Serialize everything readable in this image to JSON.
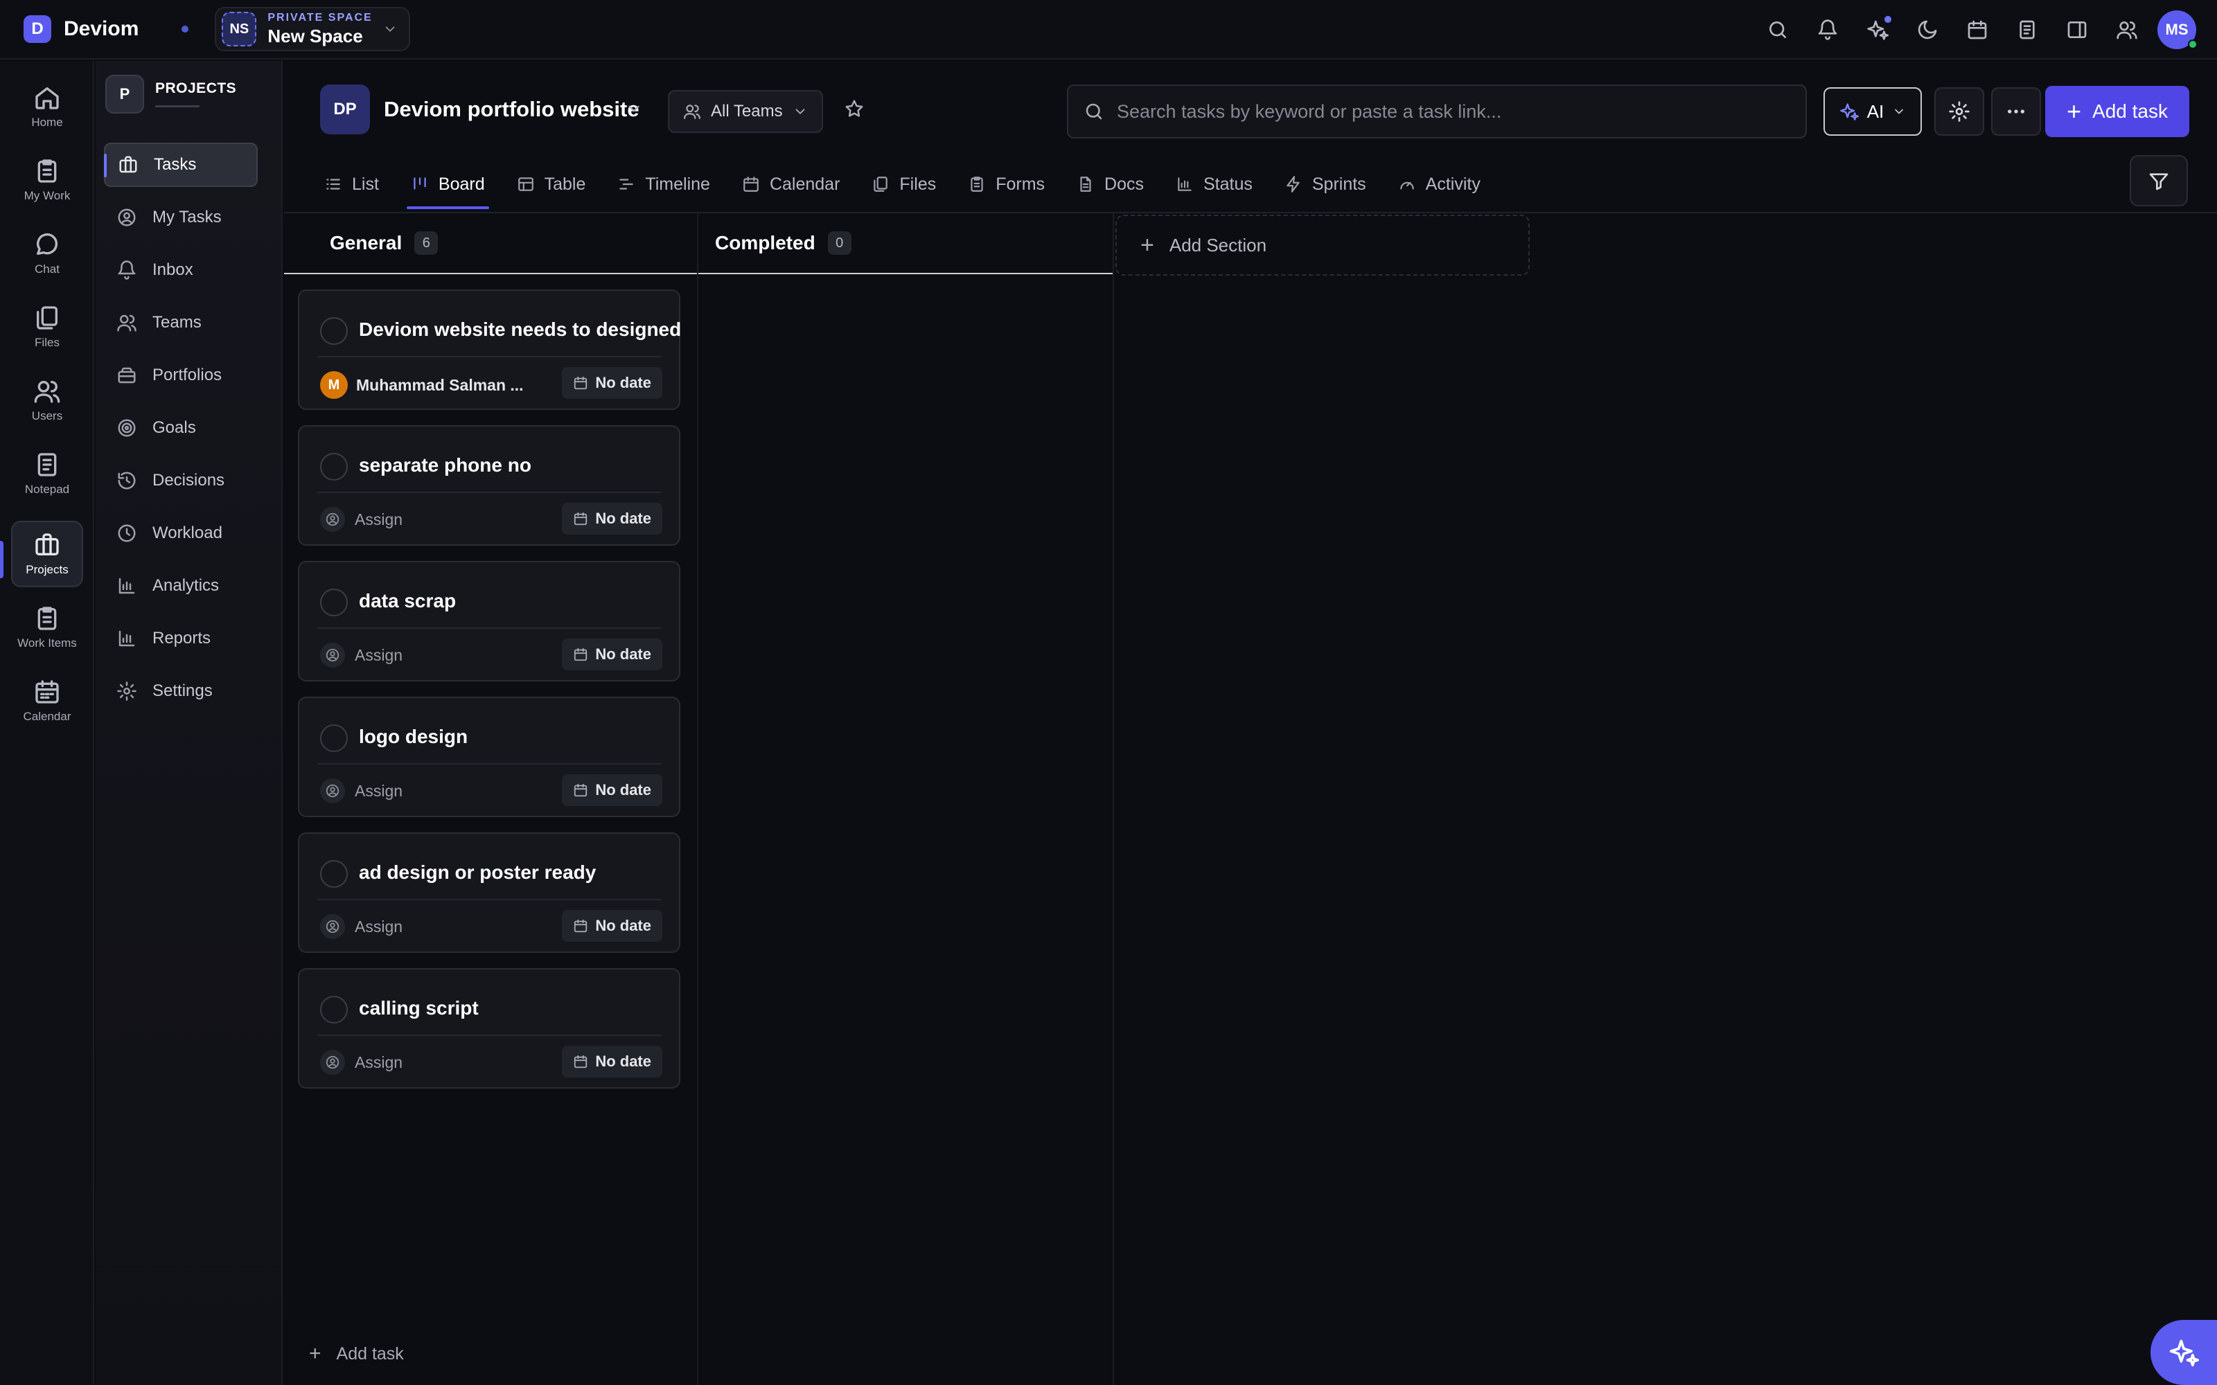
{
  "app": {
    "name": "Deviom",
    "logo_letter": "D"
  },
  "space": {
    "avatar": "NS",
    "kicker": "PRIVATE SPACE",
    "name": "New Space"
  },
  "user": {
    "initials": "MS",
    "status_color": "#27c26c"
  },
  "rail": {
    "items": [
      {
        "label": "Home",
        "icon": "home-icon"
      },
      {
        "label": "My Work",
        "icon": "clipboard-icon"
      },
      {
        "label": "Chat",
        "icon": "chat-icon"
      },
      {
        "label": "Files",
        "icon": "files-icon"
      },
      {
        "label": "Users",
        "icon": "users-icon"
      },
      {
        "label": "Notepad",
        "icon": "notepad-icon"
      },
      {
        "label": "Projects",
        "icon": "briefcase-icon"
      },
      {
        "label": "Work Items",
        "icon": "clipboard-list-icon"
      },
      {
        "label": "Calendar",
        "icon": "calendar-icon"
      }
    ],
    "active": "Projects"
  },
  "secnav": {
    "badge": "P",
    "title": "PROJECTS",
    "items": [
      {
        "label": "Tasks",
        "icon": "briefcase-icon"
      },
      {
        "label": "My Tasks",
        "icon": "user-circle-icon"
      },
      {
        "label": "Inbox",
        "icon": "bell-icon"
      },
      {
        "label": "Teams",
        "icon": "users-icon"
      },
      {
        "label": "Portfolios",
        "icon": "portfolio-icon"
      },
      {
        "label": "Goals",
        "icon": "target-icon"
      },
      {
        "label": "Decisions",
        "icon": "history-icon"
      },
      {
        "label": "Workload",
        "icon": "clock-icon"
      },
      {
        "label": "Analytics",
        "icon": "bar-chart-icon"
      },
      {
        "label": "Reports",
        "icon": "bar-chart-icon"
      },
      {
        "label": "Settings",
        "icon": "gear-icon"
      }
    ],
    "active": "Tasks"
  },
  "project": {
    "badge": "DP",
    "title": "Deviom portfolio website",
    "teams_label": "All Teams",
    "search_placeholder": "Search tasks by keyword or paste a task link...",
    "ai_label": "AI",
    "add_task_label": "Add task",
    "tabs": [
      {
        "label": "List",
        "icon": "list-icon"
      },
      {
        "label": "Board",
        "icon": "board-icon"
      },
      {
        "label": "Table",
        "icon": "table-icon"
      },
      {
        "label": "Timeline",
        "icon": "timeline-icon"
      },
      {
        "label": "Calendar",
        "icon": "calendar-icon"
      },
      {
        "label": "Files",
        "icon": "files-icon"
      },
      {
        "label": "Forms",
        "icon": "form-icon"
      },
      {
        "label": "Docs",
        "icon": "doc-icon"
      },
      {
        "label": "Status",
        "icon": "bar-chart-icon"
      },
      {
        "label": "Sprints",
        "icon": "bolt-icon"
      },
      {
        "label": "Activity",
        "icon": "gauge-icon"
      }
    ],
    "active_tab": "Board"
  },
  "board": {
    "columns": [
      {
        "title": "General",
        "count": "6",
        "add_task_label": "Add task",
        "cards": [
          {
            "title": "Deviom website needs to designed",
            "assignee": "Muhammad Salman ...",
            "assignee_initial": "M",
            "date": "No date"
          },
          {
            "title": "separate phone no",
            "assignee": "Assign",
            "date": "No date"
          },
          {
            "title": "data scrap",
            "assignee": "Assign",
            "date": "No date"
          },
          {
            "title": "logo design",
            "assignee": "Assign",
            "date": "No date"
          },
          {
            "title": "ad design or poster ready",
            "assignee": "Assign",
            "date": "No date"
          },
          {
            "title": "calling script",
            "assignee": "Assign",
            "date": "No date"
          }
        ]
      },
      {
        "title": "Completed",
        "count": "0",
        "cards": []
      }
    ],
    "add_section_label": "Add Section"
  },
  "colors": {
    "accent": "#5b5bf0",
    "primary_button": "#4f46e5",
    "background": "#0c0d12",
    "assignee_avatar": "#d97706"
  }
}
